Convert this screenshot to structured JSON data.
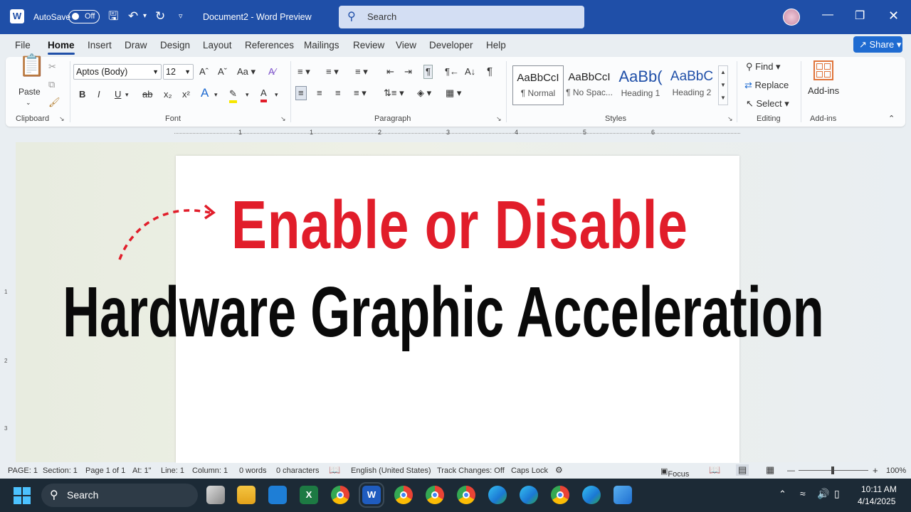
{
  "titlebar": {
    "autosave_label": "AutoSave",
    "autosave_state": "Off",
    "document_title": "Document2  -  Word Preview",
    "search_placeholder": "Search"
  },
  "tabs": [
    "File",
    "Home",
    "Insert",
    "Draw",
    "Design",
    "Layout",
    "References",
    "Mailings",
    "Review",
    "View",
    "Developer",
    "Help"
  ],
  "active_tab": "Home",
  "share_label": "Share",
  "ribbon": {
    "clipboard": {
      "paste_label": "Paste",
      "group_label": "Clipboard"
    },
    "font": {
      "font_name": "Aptos (Body)",
      "font_size": "12",
      "group_label": "Font",
      "case_label": "Aa"
    },
    "paragraph": {
      "group_label": "Paragraph"
    },
    "styles": {
      "items": [
        {
          "preview": "AaBbCcI",
          "name": "¶ Normal"
        },
        {
          "preview": "AaBbCcI",
          "name": "¶ No Spac..."
        },
        {
          "preview": "AaBb(",
          "name": "Heading 1"
        },
        {
          "preview": "AaBbC",
          "name": "Heading 2"
        }
      ],
      "group_label": "Styles"
    },
    "editing": {
      "find": "Find",
      "replace": "Replace",
      "select": "Select",
      "group_label": "Editing"
    },
    "addins": {
      "label": "Add-ins",
      "group_label": "Add-ins"
    }
  },
  "ruler_numbers": [
    "1",
    "1",
    "2",
    "3",
    "4",
    "5",
    "6"
  ],
  "vertical_ruler_numbers": [
    "1",
    "2",
    "3"
  ],
  "headline": {
    "line1": "Enable or Disable",
    "line2": "Hardware Graphic Acceleration",
    "line1_color": "#e11d2a"
  },
  "statusbar": {
    "page": "PAGE: 1",
    "section": "Section: 1",
    "page_of": "Page 1 of 1",
    "at": "At: 1\"",
    "line": "Line: 1",
    "column": "Column: 1",
    "words": "0 words",
    "characters": "0 characters",
    "language": "English (United States)",
    "track_changes": "Track Changes: Off",
    "caps_lock": "Caps Lock",
    "focus": "Focus",
    "zoom": "100%"
  },
  "taskbar": {
    "search_label": "Search",
    "time": "10:11 AM",
    "date": "4/14/2025"
  }
}
